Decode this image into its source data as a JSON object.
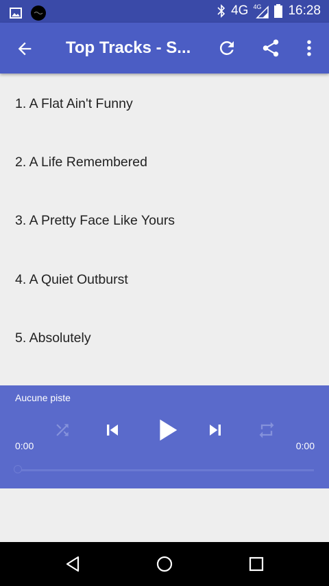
{
  "status_bar": {
    "network": "4G",
    "network_small": "4G",
    "time": "16:28",
    "icons": [
      "image-icon",
      "app-circle-icon",
      "bluetooth-icon",
      "signal-icon",
      "battery-icon"
    ]
  },
  "app_bar": {
    "title": "Top Tracks - S...",
    "icons": [
      "back-arrow-icon",
      "refresh-icon",
      "share-icon",
      "more-vert-icon"
    ]
  },
  "tracks": [
    "1. A Flat Ain't Funny",
    "2. A Life Remembered",
    "3. A Pretty Face Like Yours",
    "4. A Quiet Outburst",
    "5. Absolutely"
  ],
  "player": {
    "now_playing": "Aucune piste",
    "elapsed": "0:00",
    "duration": "0:00",
    "progress": 0,
    "icons": [
      "shuffle-icon",
      "skip-previous-icon",
      "play-icon",
      "skip-next-icon",
      "repeat-icon"
    ]
  },
  "nav_bar": {
    "icons": [
      "back-triangle-icon",
      "home-circle-icon",
      "recents-square-icon"
    ]
  },
  "colors": {
    "status_bar": "#3a4aa8",
    "app_bar": "#4b5dc4",
    "player": "#5a6acb",
    "background": "#eeeeee"
  }
}
